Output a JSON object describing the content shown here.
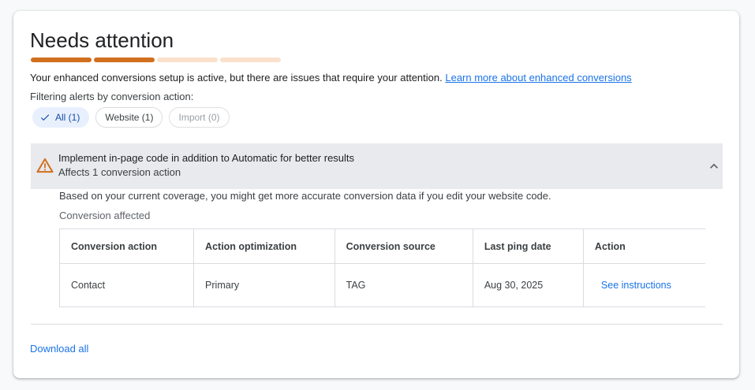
{
  "header": {
    "title": "Needs attention",
    "progress_colors": [
      "#d16f1e",
      "#d16f1e",
      "#fbe1cc",
      "#fbe1cc"
    ]
  },
  "description": {
    "text": "Your enhanced conversions setup is active, but there are issues that require your attention.",
    "link": "Learn more about enhanced conversions"
  },
  "filter": {
    "label": "Filtering alerts by conversion action:",
    "chips": [
      {
        "label": "All (1)",
        "state": "selected"
      },
      {
        "label": "Website (1)",
        "state": "default"
      },
      {
        "label": "Import (0)",
        "state": "disabled"
      }
    ]
  },
  "alert": {
    "title": "Implement in-page code in addition to Automatic for better results",
    "subtitle": "Affects 1 conversion action",
    "icon": "warning-icon",
    "icon_color": "#d16f1e",
    "body": "Based on your current coverage, you might get more accurate conversion data if you edit your website code.",
    "affected_label": "Conversion affected",
    "table": {
      "headers": [
        "Conversion action",
        "Action optimization",
        "Conversion source",
        "Last ping date",
        "Action"
      ],
      "rows": [
        [
          "Contact",
          "Primary",
          "TAG",
          "Aug 30, 2025",
          "See instructions"
        ]
      ]
    }
  },
  "footer": {
    "download_label": "Download all"
  },
  "colors": {
    "accent_link": "#1a73e8",
    "chip_selected_bg": "#e8f0fe",
    "alert_bg": "#e8eaed"
  }
}
